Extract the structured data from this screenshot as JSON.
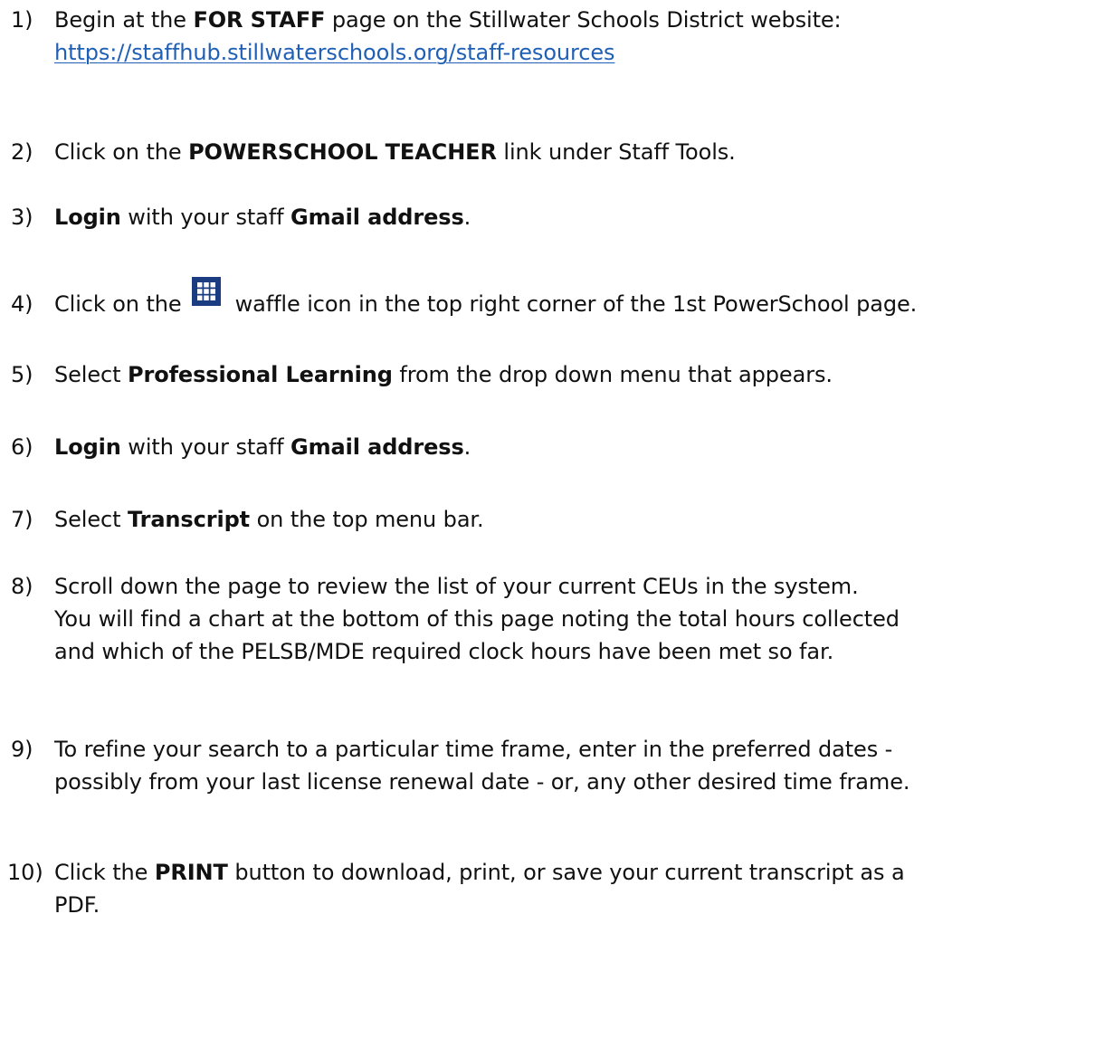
{
  "steps": [
    {
      "num": "1)",
      "t1": "Begin at the ",
      "b1": "FOR STAFF",
      "t2": " page on the Stillwater Schools District website:",
      "link": "https://staffhub.stillwaterschools.org/staff-resources"
    },
    {
      "num": "2)",
      "t1": "Click on the ",
      "b1": "POWERSCHOOL TEACHER",
      "t2": " link under Staff Tools."
    },
    {
      "num": "3)",
      "b1": "Login",
      "t1": " with your staff ",
      "b2": "Gmail address",
      "t2": "."
    },
    {
      "num": "4)",
      "t1": "Click on the ",
      "icon": "waffle-icon",
      "t2": " waffle icon in the top right corner of the 1st PowerSchool page."
    },
    {
      "num": "5)",
      "t1": "Select ",
      "b1": "Professional Learning",
      "t2": " from the drop down menu that appears."
    },
    {
      "num": "6)",
      "b1": "Login",
      "t1": " with your staff ",
      "b2": "Gmail address",
      "t2": "."
    },
    {
      "num": "7)",
      "t1": "Select ",
      "b1": "Transcript",
      "t2": " on the top menu bar."
    },
    {
      "num": "8)",
      "l1": "Scroll down the page to review the list of your current CEUs in the system.",
      "l2": "You will find a chart at the bottom of this page noting the total hours collected",
      "l3": "and which of the PELSB/MDE required clock hours have been met so far."
    },
    {
      "num": "9)",
      "l1": "To refine your search to a particular time frame, enter in the preferred dates -",
      "l2": "possibly from your last license renewal date - or, any other desired time frame."
    },
    {
      "num": "10)",
      "t1": "Click the ",
      "b1": "PRINT",
      "t2": " button to download, print, or save your current transcript as a",
      "l2": "PDF."
    }
  ],
  "colors": {
    "link": "#1f5fb5",
    "waffle_icon": "#1c3c82"
  }
}
